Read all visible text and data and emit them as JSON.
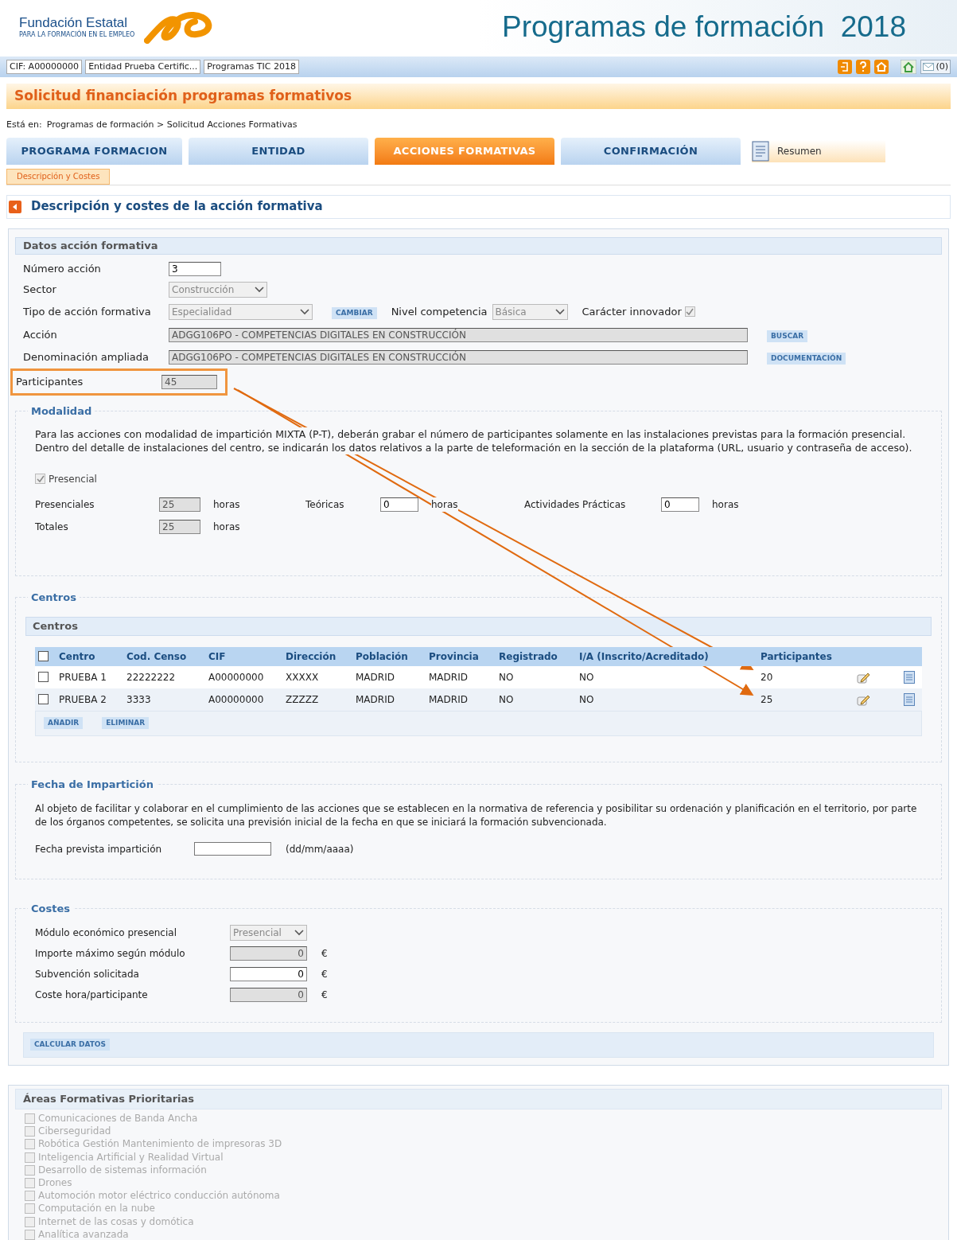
{
  "header": {
    "org_name": "Fundación Estatal",
    "org_tagline": "PARA LA FORMACIÓN EN EL EMPLEO",
    "title": "Programas de formación  2018"
  },
  "info_bar": {
    "items": [
      "CIF: A00000000",
      "Entidad Prueba Certific...",
      "Programas TIC 2018"
    ],
    "mail_count": "(0)"
  },
  "page_title": "Solicitud financiación programas formativos",
  "breadcrumb": {
    "label": "Está en:",
    "path": "Programas de formación > Solicitud Acciones Formativas"
  },
  "tabs": [
    {
      "label": "PROGRAMA FORMACION",
      "selected": false
    },
    {
      "label": "ENTIDAD",
      "selected": false
    },
    {
      "label": "ACCIONES FORMATIVAS",
      "selected": true
    },
    {
      "label": "CONFIRMACIÓN",
      "selected": false
    }
  ],
  "summary_button": "Resumen",
  "subtabs": [
    {
      "label": "Descripción y Costes",
      "selected": true
    }
  ],
  "section_title": "Descripción y costes de la acción formativa",
  "datos": {
    "title": "Datos acción formativa",
    "numero": {
      "label": "Número acción",
      "value": "3",
      "disabled": false
    },
    "sector": {
      "label": "Sector",
      "value": "Construcción",
      "disabled": true
    },
    "tipo": {
      "label": "Tipo de acción formativa",
      "value": "Especialidad",
      "disabled": true,
      "button": "CAMBIAR"
    },
    "nivel": {
      "label": "Nivel competencia",
      "value": "Básica",
      "disabled": true
    },
    "innovador": {
      "label": "Carácter innovador",
      "checked": true
    },
    "accion": {
      "label": "Acción",
      "value": "ADGG106PO - COMPETENCIAS DIGITALES EN CONSTRUCCIÓN",
      "disabled": true,
      "button": "BUSCAR"
    },
    "denominacion": {
      "label": "Denominación ampliada",
      "value": "ADGG106PO - COMPETENCIAS DIGITALES EN CONSTRUCCIÓN",
      "disabled": true,
      "button": "DOCUMENTACIÓN"
    },
    "participantes": {
      "label": "Participantes",
      "value": "45",
      "disabled": true
    }
  },
  "modalidad": {
    "title": "Modalidad",
    "note": "Para las acciones con modalidad de impartición MIXTA (P-T), deberán grabar el número de participantes solamente en las instalaciones previstas para la formación presencial. Dentro del detalle de instalaciones del centro, se indicarán los datos relativos a la parte de teleformación en la sección de la plataforma (URL, usuario y contraseña de acceso).",
    "presencial": {
      "label": "Presencial",
      "checked": true
    },
    "hours": [
      [
        {
          "label": "Presenciales",
          "value": "25",
          "disabled": true,
          "unit": "horas"
        },
        {
          "label": "Teóricas",
          "value": "0",
          "disabled": false,
          "unit": "horas"
        },
        {
          "label": "Actividades Prácticas",
          "value": "0",
          "disabled": false,
          "unit": "horas"
        }
      ],
      [
        {
          "label": "Totales",
          "value": "25",
          "disabled": true,
          "unit": "horas"
        }
      ]
    ]
  },
  "centros": {
    "title": "Centros",
    "header": "Centros",
    "all_checked": false,
    "columns": [
      "Centro",
      "Cod. Censo",
      "CIF",
      "Dirección",
      "Población",
      "Provincia",
      "Registrado",
      "I/A (Inscrito/Acreditado)",
      "Participantes"
    ],
    "rows": [
      {
        "checked": false,
        "cells": [
          "PRUEBA 1",
          "22222222",
          "A00000000",
          "XXXXX",
          "MADRID",
          "MADRID",
          "NO",
          "NO",
          "20"
        ]
      },
      {
        "checked": false,
        "cells": [
          "PRUEBA 2",
          "3333",
          "A00000000",
          "ZZZZZ",
          "MADRID",
          "MADRID",
          "NO",
          "NO",
          "25"
        ]
      }
    ],
    "buttons": [
      "AÑADIR",
      "ELIMINAR"
    ]
  },
  "fecha": {
    "title": "Fecha de Impartición",
    "note": "Al objeto de facilitar y colaborar en el cumplimiento de las acciones que se establecen en la normativa de referencia y posibilitar su ordenación y planificación en el territorio, por parte de los órganos competentes, se solicita una previsión inicial de la fecha en que se iniciará la formación subvencionada.",
    "label": "Fecha prevista impartición",
    "format": "(dd/mm/aaaa)"
  },
  "costes": {
    "title": "Costes",
    "modulo": {
      "label": "Módulo económico presencial",
      "value": "Presencial",
      "disabled": true
    },
    "rows": [
      {
        "label": "Importe máximo según módulo",
        "value": "0",
        "disabled": true,
        "unit": "€"
      },
      {
        "label": "Subvención solicitada",
        "value": "0",
        "disabled": false,
        "unit": "€"
      },
      {
        "label": "Coste hora/participante",
        "value": "0",
        "disabled": true,
        "unit": "€"
      }
    ],
    "button": "CALCULAR DATOS"
  },
  "areas": {
    "title": "Áreas Formativas Prioritarias",
    "items": [
      {
        "label": "Comunicaciones de Banda Ancha",
        "checked": false,
        "disabled": true
      },
      {
        "label": "Ciberseguridad",
        "checked": false,
        "disabled": true
      },
      {
        "label": "Robótica Gestión Mantenimiento de impresoras 3D",
        "checked": false,
        "disabled": true
      },
      {
        "label": "Inteligencia Artificial y Realidad Virtual",
        "checked": false,
        "disabled": true
      },
      {
        "label": "Desarrollo de sistemas información",
        "checked": false,
        "disabled": true
      },
      {
        "label": "Drones",
        "checked": false,
        "disabled": true
      },
      {
        "label": "Automoción motor eléctrico conducción autónoma",
        "checked": false,
        "disabled": true
      },
      {
        "label": "Computación en la nube",
        "checked": false,
        "disabled": true
      },
      {
        "label": "Internet de las cosas y domótica",
        "checked": false,
        "disabled": true
      },
      {
        "label": "Analítica avanzada",
        "checked": false,
        "disabled": true
      }
    ]
  }
}
